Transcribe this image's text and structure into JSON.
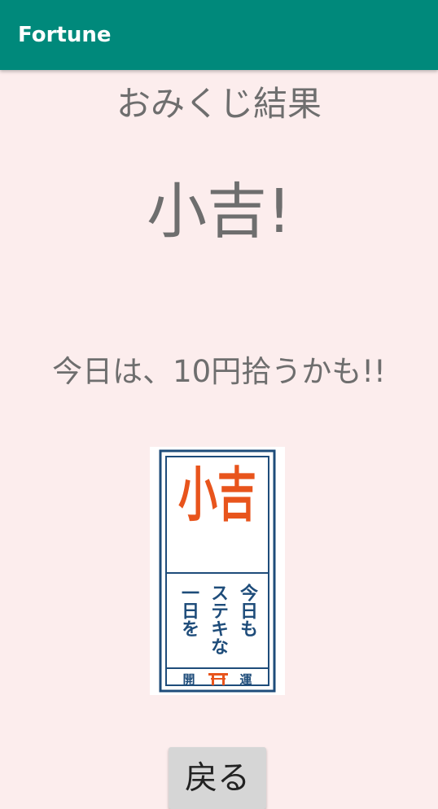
{
  "app_bar": {
    "title": "Fortune",
    "color": "#00897B"
  },
  "main": {
    "heading": "おみくじ結果",
    "result": "小吉!",
    "message": "今日は、10円拾うかも!!",
    "background": "#FCEDED"
  },
  "omikuji_image": {
    "big_text": "小吉",
    "line1": "今日も",
    "line2": "ステキな",
    "line3": "一日を",
    "footer_left": "開",
    "footer_right": "運",
    "icon": "torii-gate-icon",
    "accent": "#E8541C",
    "border": "#1E4C7A"
  },
  "actions": {
    "back_label": "戻る"
  }
}
